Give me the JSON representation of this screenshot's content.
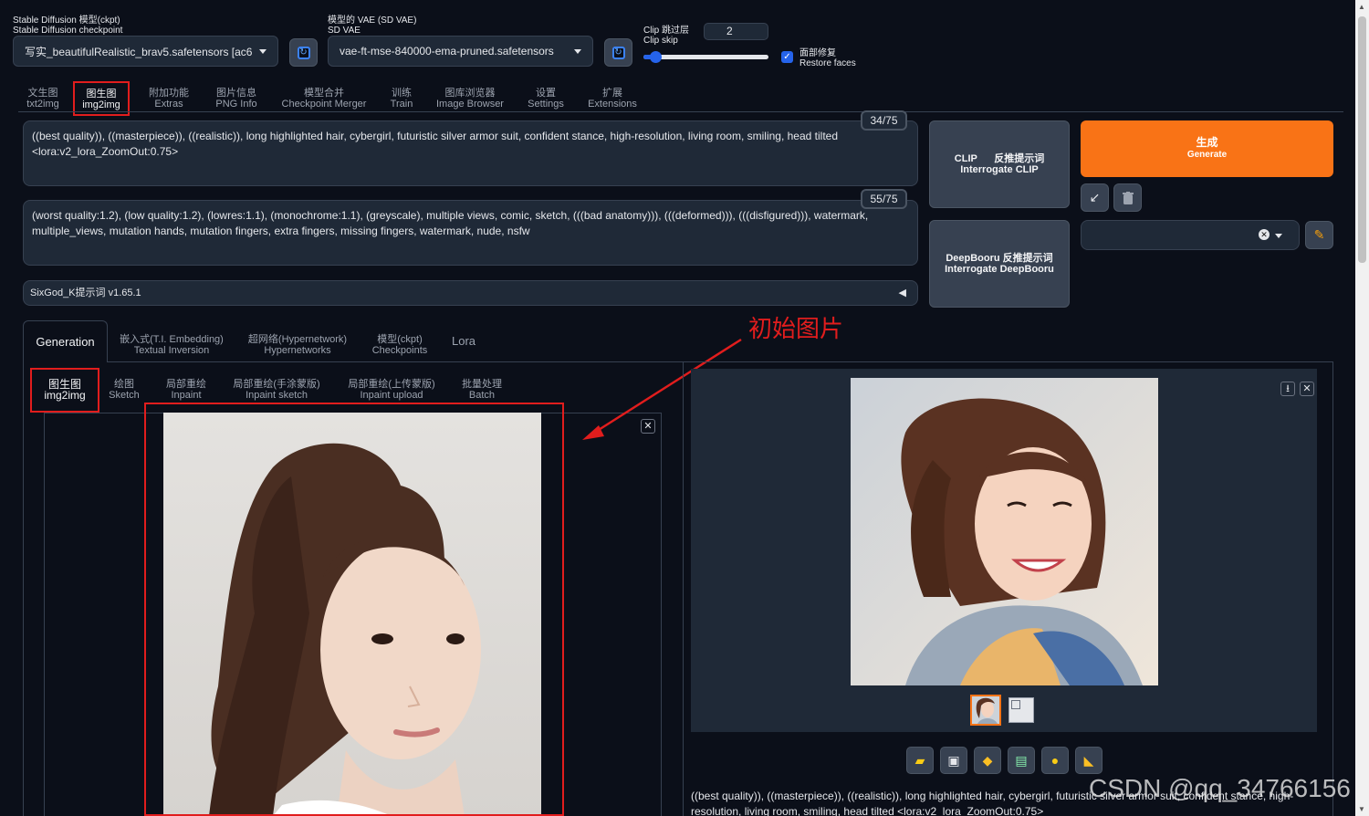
{
  "top": {
    "ckpt_label_cn": "Stable Diffusion 模型(ckpt)",
    "ckpt_label_en": "Stable Diffusion checkpoint",
    "ckpt_value": "写实_beautifulRealistic_brav5.safetensors [ac6f",
    "vae_label_cn": "模型的 VAE (SD VAE)",
    "vae_label_en": "SD VAE",
    "vae_value": "vae-ft-mse-840000-ema-pruned.safetensors",
    "clip_label_cn": "Clip 跳过层",
    "clip_label_en": "Clip skip",
    "clip_value": "2",
    "clip_fraction": 0.05,
    "restore_cn": "面部修复",
    "restore_en": "Restore faces"
  },
  "main_tabs": [
    {
      "cn": "文生图",
      "en": "txt2img"
    },
    {
      "cn": "图生图",
      "en": "img2img"
    },
    {
      "cn": "附加功能",
      "en": "Extras"
    },
    {
      "cn": "图片信息",
      "en": "PNG Info"
    },
    {
      "cn": "模型合并",
      "en": "Checkpoint Merger"
    },
    {
      "cn": "训练",
      "en": "Train"
    },
    {
      "cn": "图库浏览器",
      "en": "Image Browser"
    },
    {
      "cn": "设置",
      "en": "Settings"
    },
    {
      "cn": "扩展",
      "en": "Extensions"
    }
  ],
  "prompt": {
    "counter": "34/75",
    "text": "((best quality)), ((masterpiece)), ((realistic)), long highlighted hair, cybergirl, futuristic silver armor suit, confident stance, high-resolution, living room, smiling, head tilted <lora:v2_lora_ZoomOut:0.75>"
  },
  "negative": {
    "counter": "55/75",
    "text": "(worst quality:1.2), (low quality:1.2), (lowres:1.1), (monochrome:1.1), (greyscale), multiple views, comic, sketch, (((bad anatomy))), (((deformed))), (((disfigured))), watermark, multiple_views, mutation hands, mutation fingers, extra fingers, missing fingers, watermark, nude, nsfw"
  },
  "sixgod": "SixGod_K提示词 v1.65.1",
  "buttons": {
    "clip_cn": "反推提示词",
    "clip_en1": "CLIP",
    "clip_en2": "Interrogate CLIP",
    "deepbooru_cn": "DeepBooru 反推提示词",
    "deepbooru_en": "Interrogate DeepBooru",
    "generate_cn": "生成",
    "generate_en": "Generate"
  },
  "sub_tabs": [
    {
      "text": "Generation"
    },
    {
      "cn": "嵌入式(T.I. Embedding)",
      "en": "Textual Inversion"
    },
    {
      "cn": "超网络(Hypernetwork)",
      "en": "Hypernetworks"
    },
    {
      "cn": "模型(ckpt)",
      "en": "Checkpoints"
    },
    {
      "text": "Lora"
    }
  ],
  "img_tabs": [
    {
      "cn": "图生图",
      "en": "img2img"
    },
    {
      "cn": "绘图",
      "en": "Sketch"
    },
    {
      "cn": "局部重绘",
      "en": "Inpaint"
    },
    {
      "cn": "局部重绘(手涂蒙版)",
      "en": "Inpaint sketch"
    },
    {
      "cn": "局部重绘(上传蒙版)",
      "en": "Inpaint upload"
    },
    {
      "cn": "批量处理",
      "en": "Batch"
    }
  ],
  "annotation": "初始图片",
  "output_text": "((best quality)), ((masterpiece)), ((realistic)), long highlighted hair, cybergirl, futuristic silver armor suit, confident stance, high-resolution, living room, smiling, head tilted <lora:v2_lora_ZoomOut:0.75>",
  "watermark": "CSDN @qq_34766156",
  "colors": {
    "accent_orange": "#f97316",
    "annotation_red": "#e11d1d",
    "bg": "#0b0f19"
  }
}
